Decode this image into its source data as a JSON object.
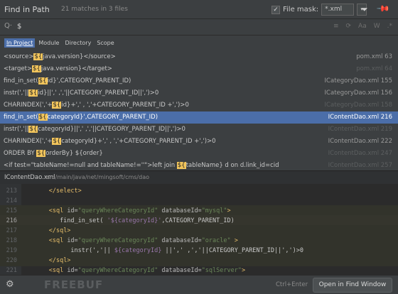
{
  "header": {
    "title": "Find in Path",
    "count": "21 matches in 3 files",
    "file_mask_label": "File mask:",
    "file_mask_value": "*.xml"
  },
  "search": {
    "query": "$",
    "options": [
      "≡",
      "⟳",
      "Aa",
      "W",
      ".*"
    ]
  },
  "scope": {
    "tabs": [
      "In Project",
      "Module",
      "Directory",
      "Scope"
    ]
  },
  "results": [
    {
      "pre": "<source>",
      "hl": "${",
      "post": "java.version}</source>",
      "file": "pom.xml 63",
      "dim": false
    },
    {
      "pre": "<target>",
      "hl": "${",
      "post": "java.version}</target>",
      "file": "pom.xml 64",
      "dim": true
    },
    {
      "pre": "find_in_set(",
      "hl": "${",
      "post": "id}',CATEGORY_PARENT_ID)",
      "file": "ICategoryDao.xml 155",
      "dim": false
    },
    {
      "pre": "instr(','||",
      "hl": "${",
      "post": "id}||',' ,','||CATEGORY_PARENT_ID||',')>0",
      "file": "ICategoryDao.xml 156",
      "dim": false
    },
    {
      "pre": "CHARINDEX(','+",
      "hl": "${",
      "post": "id}+',' , ','+CATEGORY_PARENT_ID +',')>0",
      "file": "ICategoryDao.xml 158",
      "dim": true
    },
    {
      "pre": "find_in_set(",
      "hl": "${",
      "post": "categoryId}',CATEGORY_PARENT_ID)",
      "file": "IContentDao.xml 216",
      "dim": false
    },
    {
      "pre": "instr(','||",
      "hl": "${",
      "post": "categoryId}||',' ,','||CATEGORY_PARENT_ID||',')>0",
      "file": "IContentDao.xml 219",
      "dim": true
    },
    {
      "pre": "CHARINDEX(','+",
      "hl": "${",
      "post": "categoryId}+',' , ','+CATEGORY_PARENT_ID +',')>0",
      "file": "IContentDao.xml 222",
      "dim": false
    },
    {
      "pre": "ORDER BY ",
      "hl": "${",
      "post": "orderBy} ${order}",
      "file": "IContentDao.xml 247",
      "dim": true
    },
    {
      "pre": "<if test=\"tableName!=null and tableName!=''\">left join ",
      "hl": "${",
      "post": "tableName} d on d.link_id=cid",
      "file": "IContentDao.xml 257",
      "dim": true
    }
  ],
  "selected_index": 5,
  "preview": {
    "file_name": "IContentDao.xml",
    "file_path": "src/main/java/net/mingsoft/cms/dao",
    "lines": [
      {
        "n": "213",
        "indent": "      ",
        "tokens": [
          {
            "t": "</select>",
            "c": "tag"
          }
        ]
      },
      {
        "n": "214",
        "indent": "",
        "tokens": []
      },
      {
        "n": "215",
        "indent": "      ",
        "tokens": [
          {
            "t": "<sql ",
            "c": "tag"
          },
          {
            "t": "id=",
            "c": "attr"
          },
          {
            "t": "\"queryWhereCategoryId\"",
            "c": "str"
          },
          {
            "t": " databaseId=",
            "c": "attr"
          },
          {
            "t": "\"mysql\"",
            "c": "str"
          },
          {
            "t": ">",
            "c": "tag"
          }
        ]
      },
      {
        "n": "216",
        "indent": "         ",
        "tokens": [
          {
            "t": "find_in_set( ",
            "c": "plain"
          },
          {
            "t": "'${categoryId}'",
            "c": "var"
          },
          {
            "t": ",CATEGORY_PARENT_ID)",
            "c": "plain"
          }
        ]
      },
      {
        "n": "217",
        "indent": "      ",
        "tokens": [
          {
            "t": "</sql>",
            "c": "tag"
          }
        ]
      },
      {
        "n": "218",
        "indent": "      ",
        "tokens": [
          {
            "t": "<sql ",
            "c": "tag"
          },
          {
            "t": "id=",
            "c": "attr"
          },
          {
            "t": "\"queryWhereCategoryId\"",
            "c": "str"
          },
          {
            "t": " databaseId=",
            "c": "attr"
          },
          {
            "t": "\"oracle\"",
            "c": "str"
          },
          {
            "t": " >",
            "c": "tag"
          }
        ]
      },
      {
        "n": "219",
        "indent": "            ",
        "tokens": [
          {
            "t": "instr(','|| ",
            "c": "plain"
          },
          {
            "t": "${categoryId}",
            "c": "var"
          },
          {
            "t": " ||',' ,','||CATEGORY_PARENT_ID||',')>0",
            "c": "plain"
          }
        ]
      },
      {
        "n": "220",
        "indent": "      ",
        "tokens": [
          {
            "t": "</sql>",
            "c": "tag"
          }
        ]
      },
      {
        "n": "221",
        "indent": "      ",
        "tokens": [
          {
            "t": "<sql ",
            "c": "tag"
          },
          {
            "t": "id=",
            "c": "attr"
          },
          {
            "t": "\"queryWhereCategoryId\"",
            "c": "str"
          },
          {
            "t": " databaseId=",
            "c": "attr"
          },
          {
            "t": "\"sqlServer\"",
            "c": "str"
          },
          {
            "t": ">",
            "c": "tag"
          }
        ]
      }
    ],
    "current_line": "216",
    "highlighted_lines": [
      "215",
      "216",
      "217",
      "218",
      "219",
      "220"
    ]
  },
  "footer": {
    "watermark": "FREEBUF",
    "shortcut": "Ctrl+Enter",
    "open_button": "Open in Find Window"
  },
  "colors": {
    "selection": "#4b6ea9",
    "match_highlight": "#f2c55c",
    "tag": "#e8bf6a",
    "string": "#6a8759"
  }
}
